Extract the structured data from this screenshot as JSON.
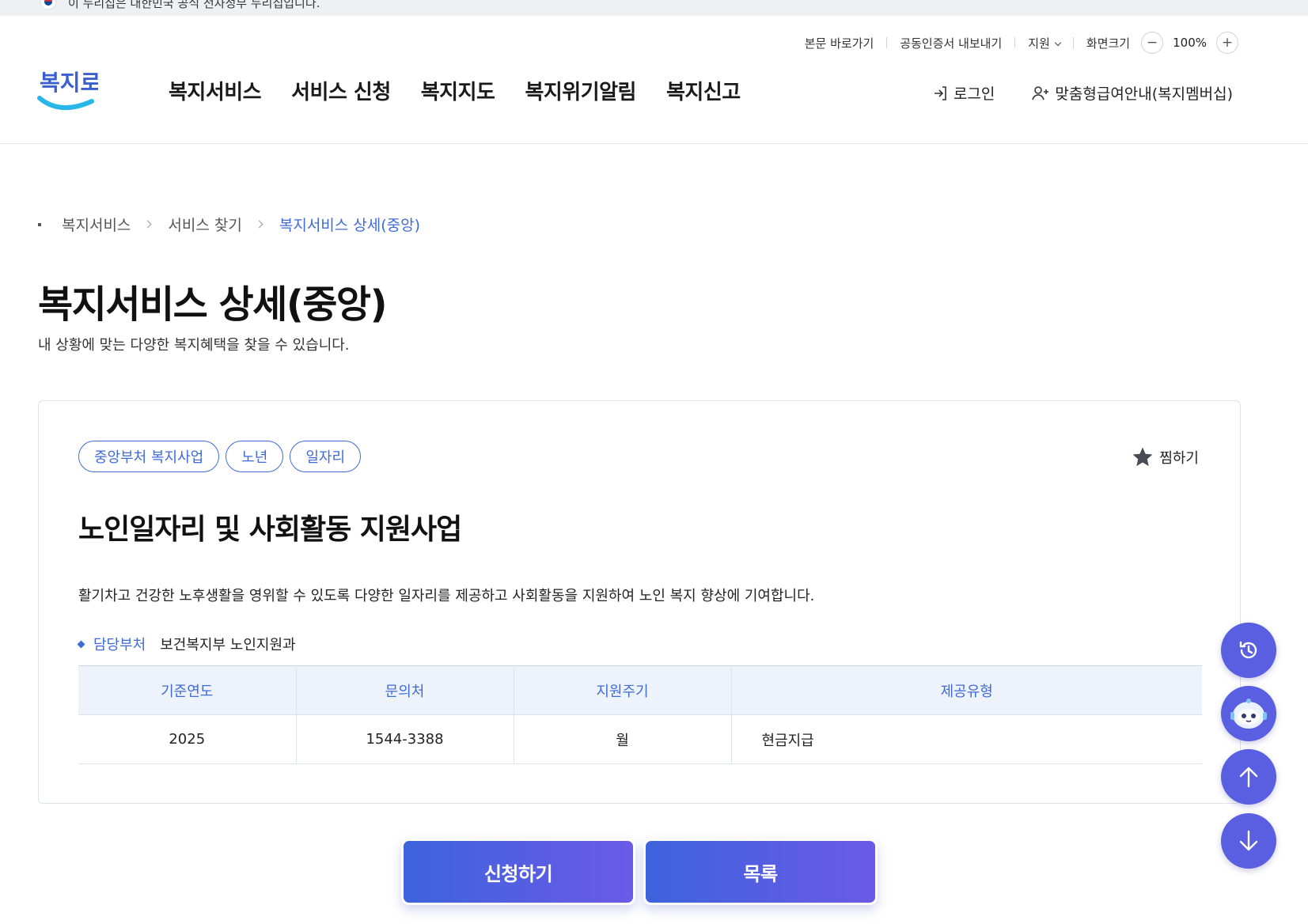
{
  "gov_banner": {
    "text": "이 누리집은 대한민국 공식 전자정부 누리집입니다."
  },
  "utility": {
    "skip_link": "본문 바로가기",
    "cert_export": "공동인증서 내보내기",
    "support": "지원",
    "zoom_label": "화면크기",
    "zoom_minus": "−",
    "zoom_value": "100%",
    "zoom_plus": "+"
  },
  "logo": {
    "text": "복지로"
  },
  "gnb": {
    "items": [
      "복지서비스",
      "서비스 신청",
      "복지지도",
      "복지위기알림",
      "복지신고"
    ]
  },
  "auth": {
    "login": "로그인",
    "membership": "맞춤형급여안내(복지멤버십)"
  },
  "breadcrumb": {
    "items": [
      "복지서비스",
      "서비스 찾기",
      "복지서비스 상세(중앙)"
    ]
  },
  "page": {
    "title": "복지서비스 상세(중앙)",
    "subtitle": "내 상황에 맞는 다양한 복지혜택을 찾을 수 있습니다."
  },
  "service": {
    "tags": [
      "중앙부처 복지사업",
      "노년",
      "일자리"
    ],
    "favorite": "찜하기",
    "title": "노인일자리 및 사회활동 지원사업",
    "description": "활기차고 건강한 노후생활을 영위할 수 있도록 다양한 일자리를 제공하고 사회활동을 지원하여 노인 복지 향상에 기여합니다.",
    "dept_label": "담당부처",
    "dept_value": "보건복지부 노인지원과",
    "table": {
      "headers": [
        "기준연도",
        "문의처",
        "지원주기",
        "제공유형"
      ],
      "row": [
        "2025",
        "1544-3388",
        "월",
        "현금지급"
      ]
    }
  },
  "actions": {
    "apply": "신청하기",
    "list": "목록"
  },
  "floating": [
    "history-icon",
    "chatbot-icon",
    "arrow-up-icon",
    "arrow-down-icon"
  ],
  "colors": {
    "accent": "#3f6ad8",
    "button_start": "#3d63dd",
    "button_end": "#6b5ae6",
    "float": "#5a5ee0"
  }
}
